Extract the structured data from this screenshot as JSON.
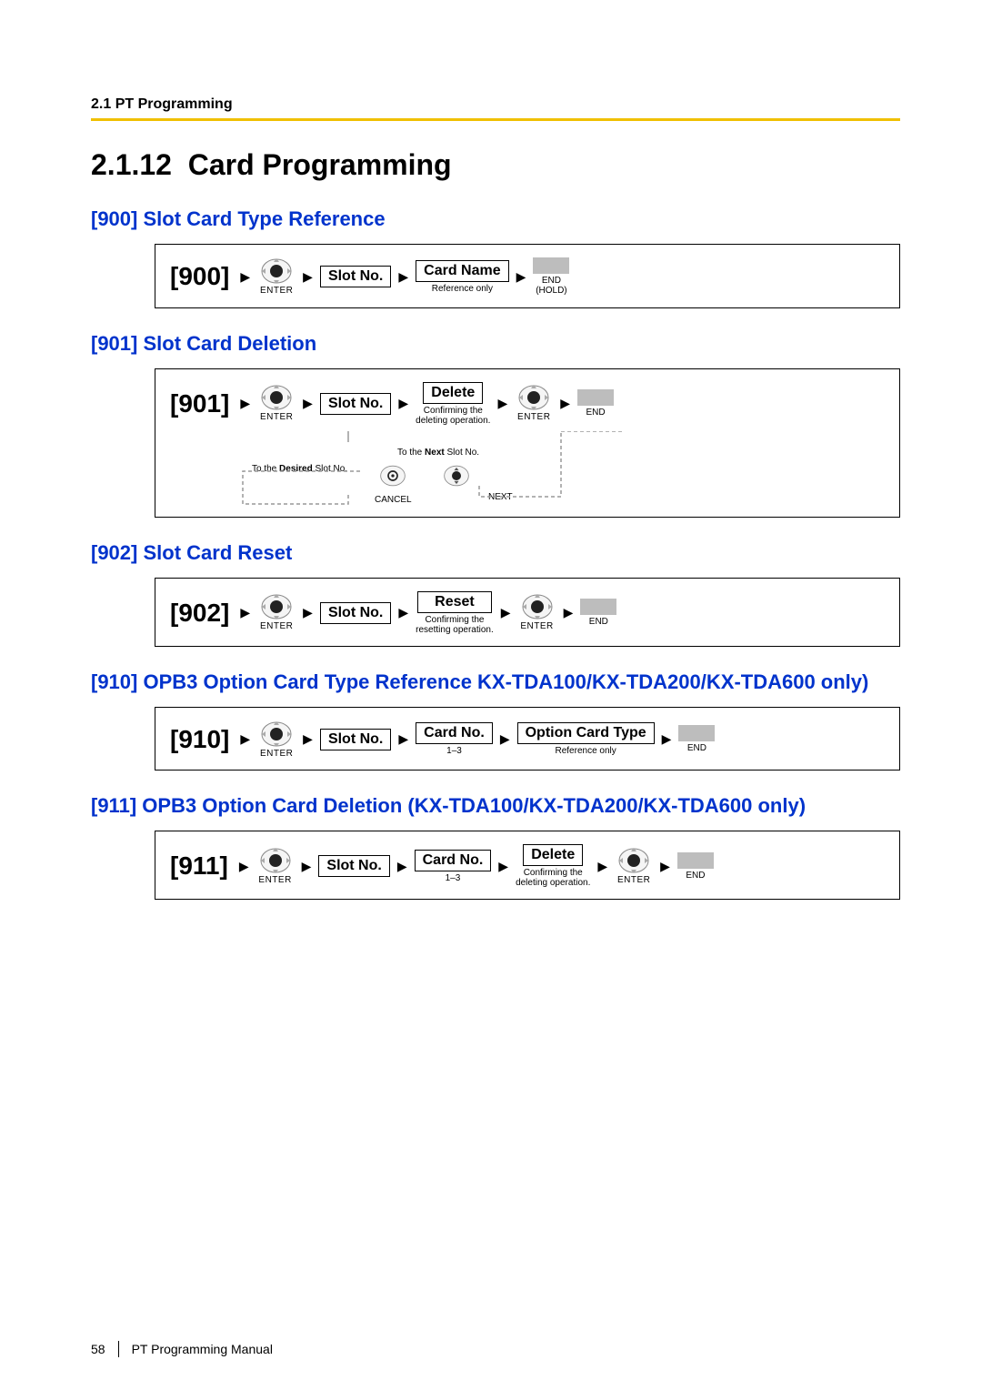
{
  "header": {
    "breadcrumb": "2.1 PT Programming"
  },
  "section": {
    "number": "2.1.12",
    "title": "Card Programming"
  },
  "items": [
    {
      "code": "[900]",
      "title": "[900] Slot Card Type Reference",
      "steps": {
        "enter": "ENTER",
        "slot": "Slot No.",
        "cardName": "Card Name",
        "refOnly": "Reference only",
        "end": "END",
        "hold": "(HOLD)"
      }
    },
    {
      "code": "[901]",
      "title": "[901] Slot Card Deletion",
      "steps": {
        "enter": "ENTER",
        "slot": "Slot No.",
        "delete": "Delete",
        "confirm": "Confirming the\ndeleting operation.",
        "end": "END",
        "toNext": "To the Next Slot No.",
        "toDesired": "To the Desired Slot No.",
        "cancel": "CANCEL",
        "next": "NEXT"
      }
    },
    {
      "code": "[902]",
      "title": "[902] Slot Card Reset",
      "steps": {
        "enter": "ENTER",
        "slot": "Slot No.",
        "reset": "Reset",
        "confirm": "Confirming the\nresetting operation.",
        "end": "END"
      }
    },
    {
      "code": "[910]",
      "title": "[910] OPB3 Option Card Type Reference KX-TDA100/KX-TDA200/KX-TDA600 only)",
      "steps": {
        "enter": "ENTER",
        "slot": "Slot No.",
        "cardNo": "Card No.",
        "range": "1–3",
        "optionType": "Option Card Type",
        "refOnly": "Reference only",
        "end": "END"
      }
    },
    {
      "code": "[911]",
      "title": "[911] OPB3 Option Card Deletion (KX-TDA100/KX-TDA200/KX-TDA600 only)",
      "steps": {
        "enter": "ENTER",
        "slot": "Slot No.",
        "cardNo": "Card No.",
        "range": "1–3",
        "delete": "Delete",
        "confirm": "Confirming the\ndeleting operation.",
        "end": "END"
      }
    }
  ],
  "footer": {
    "pageNum": "58",
    "manual": "PT Programming Manual"
  },
  "glyphs": {
    "arrow": "▶"
  }
}
